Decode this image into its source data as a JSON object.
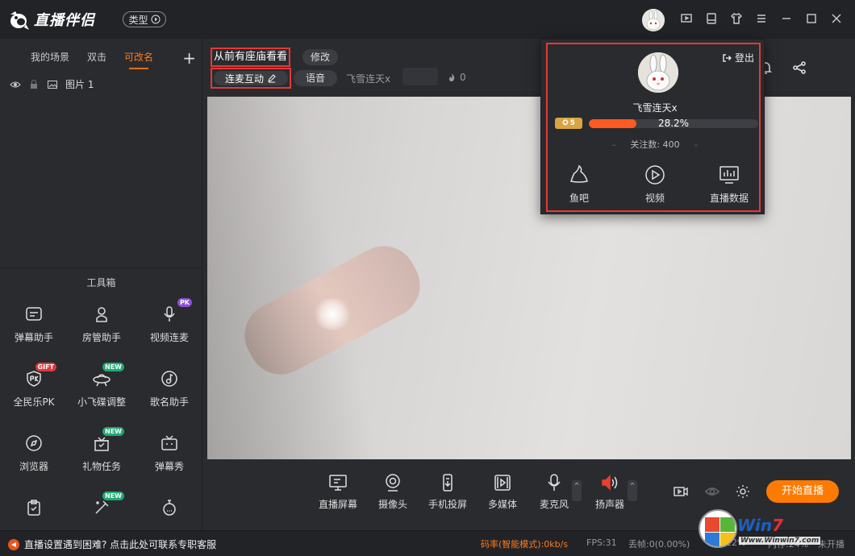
{
  "app": {
    "title": "直播伴侣",
    "type_button": "类型"
  },
  "scene_tabs": [
    {
      "label": "我的场景",
      "active": false
    },
    {
      "label": "双击",
      "active": false
    },
    {
      "label": "可改名",
      "active": true
    }
  ],
  "layer": {
    "label": "图片 1"
  },
  "toolbox": {
    "title": "工具箱",
    "items": [
      {
        "label": "弹幕助手",
        "icon": "danmu-icon",
        "badge": ""
      },
      {
        "label": "房管助手",
        "icon": "admin-icon",
        "badge": ""
      },
      {
        "label": "视频连麦",
        "icon": "mic-icon",
        "badge": "PK"
      },
      {
        "label": "全民乐PK",
        "icon": "pk-shield-icon",
        "badge": "GIFT"
      },
      {
        "label": "小飞碟调整",
        "icon": "ufo-icon",
        "badge": "NEW"
      },
      {
        "label": "歌名助手",
        "icon": "music-icon",
        "badge": ""
      },
      {
        "label": "浏览器",
        "icon": "compass-icon",
        "badge": ""
      },
      {
        "label": "礼物任务",
        "icon": "gift-icon",
        "badge": "NEW"
      },
      {
        "label": "弹幕秀",
        "icon": "tv-icon",
        "badge": ""
      },
      {
        "label": "",
        "icon": "clipboard-icon",
        "badge": ""
      },
      {
        "label": "",
        "icon": "wand-icon",
        "badge": "NEW"
      },
      {
        "label": "",
        "icon": "timer-icon",
        "badge": ""
      }
    ]
  },
  "room": {
    "title": "从前有座庙看看",
    "edit": "修改",
    "connect": "连麦互动",
    "voice": "语音",
    "nickname": "飞雪连天x",
    "heat": "0"
  },
  "bottom_tools": [
    {
      "label": "直播屏幕",
      "icon": "screen-icon"
    },
    {
      "label": "摄像头",
      "icon": "camera-icon"
    },
    {
      "label": "手机投屏",
      "icon": "phone-icon"
    },
    {
      "label": "多媒体",
      "icon": "media-icon"
    },
    {
      "label": "麦克风",
      "icon": "microphone-icon"
    },
    {
      "label": "扬声器",
      "icon": "speaker-icon"
    }
  ],
  "go_live": "开始直播",
  "popup": {
    "logout": "登出",
    "nickname": "飞雪连天x",
    "level": "5",
    "progress": 28.2,
    "progress_label": "28.2%",
    "follows": "关注数: 400",
    "items": [
      {
        "label": "鱼吧",
        "icon": "fish-bar-icon"
      },
      {
        "label": "视频",
        "icon": "video-play-icon"
      },
      {
        "label": "直播数据",
        "icon": "data-chart-icon"
      }
    ]
  },
  "status": {
    "help": "直播设置遇到困难? 点击此处可联系专职客服",
    "bitrate": "码率(智能模式):0kb/s",
    "fps": "FPS:31",
    "dropped": "丢帧:0(0.00%)",
    "cpu": "22%",
    "memory": "内存:24%",
    "live_state": "未开播"
  },
  "watermark": {
    "brand_a": "Win",
    "brand_b": "7",
    "url": "Www.Winwin7.com"
  },
  "colors": {
    "accent": "#ff7a00",
    "highlight_box": "#e53935",
    "progress": "#ff5a1f"
  }
}
